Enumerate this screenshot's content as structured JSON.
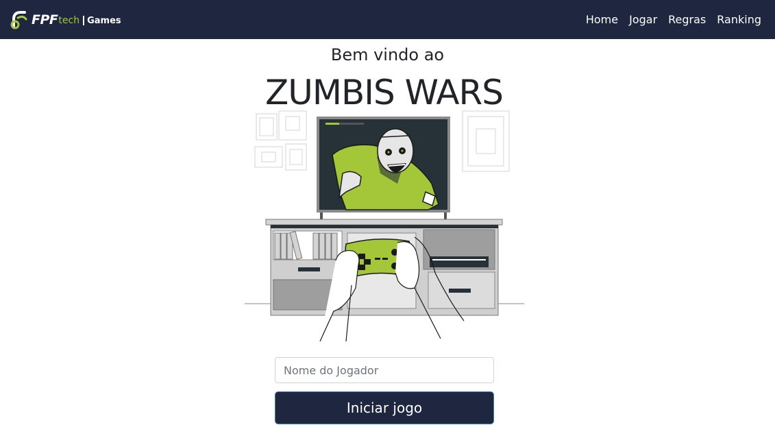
{
  "navbar": {
    "brand": {
      "fpf": "FPF",
      "tech": "tech",
      "games": "Games"
    },
    "links": [
      {
        "label": "Home"
      },
      {
        "label": "Jogar"
      },
      {
        "label": "Regras"
      },
      {
        "label": "Ranking"
      }
    ]
  },
  "hero": {
    "welcome": "Bem vindo ao",
    "title": "ZUMBIS WARS"
  },
  "form": {
    "player_name_placeholder": "Nome do Jogador",
    "player_name_value": "",
    "start_label": "Iniciar jogo"
  },
  "colors": {
    "navbar": "#1e2640",
    "accent": "#a4c639",
    "button_border": "#3d7cc9"
  },
  "illustration": {
    "description_icon": "zombie-tv-gamer-illustration"
  }
}
